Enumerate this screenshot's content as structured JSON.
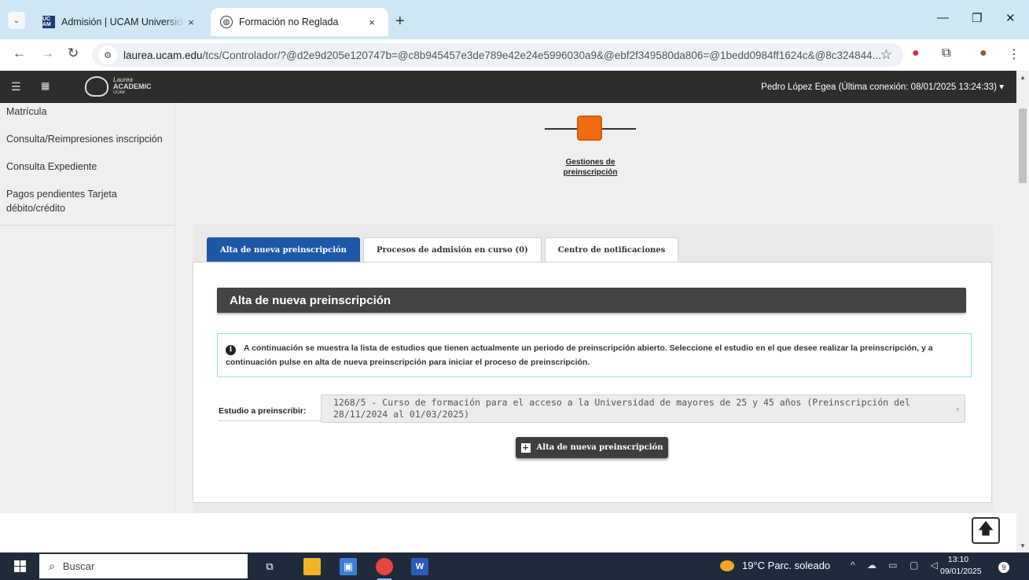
{
  "browser": {
    "tabs": [
      {
        "title": "Admisión | UCAM Universidad Católica de Murcia",
        "favicon": "UC AM",
        "active": false
      },
      {
        "title": "Formación no Reglada",
        "favicon": "globe-icon",
        "active": true
      }
    ],
    "new_tab": "+",
    "close": "×",
    "url_host": "laurea.ucam.edu",
    "url_path": "/tcs/Controlador/?@d2e9d205e120747b=@c8b945457e3de789e42e24e5996030a9&@ebf2f349580da806=@1bedd0984ff1624c&@8c324844..."
  },
  "app": {
    "logo_top": "Laurea",
    "logo_main": "ACADEMIC",
    "logo_sub": "UCAM",
    "user": "Pedro López Egea (Última conexión: 08/01/2025 13:24:33)"
  },
  "sidebar": {
    "items": [
      {
        "label": "Matrícula"
      },
      {
        "label": "Consulta/Reimpresiones inscripción"
      },
      {
        "label": "Consulta Expediente"
      },
      {
        "label": "Pagos pendientes Tarjeta débito/crédito"
      }
    ]
  },
  "stepper": {
    "label": "Gestiones de preinscripción"
  },
  "tabs": [
    {
      "label": "Alta de nueva preinscripción",
      "active": true
    },
    {
      "label": "Procesos de admisión en curso (0)",
      "active": false
    },
    {
      "label": "Centro de notificaciones",
      "active": false
    }
  ],
  "main": {
    "section_title": "Alta de nueva preinscripción",
    "info": "A continuación se muestra la lista de estudios que tienen actualmente un periodo de preinscripción abierto. Seleccione el estudio en el que desee realizar la preinscripción, y a continuación pulse en alta de nueva preinscripción para iniciar el proceso de preinscripción.",
    "field_label": "Estudio a preinscribir:",
    "selected_study": "1268/5 - Curso de formación para el acceso a la Universidad de mayores de 25 y 45 años (Preinscripción del 28/11/2024 al 01/03/2025)",
    "button_label": "Alta de nueva preinscripción"
  },
  "taskbar": {
    "search_placeholder": "Buscar",
    "weather": "19°C  Parc. soleado",
    "time": "13:10",
    "date": "09/01/2025",
    "notifications": "9"
  },
  "colors": {
    "accent_tab": "#1d57a8",
    "step": "#f26b11",
    "section_bar": "#444444",
    "info_border": "#8fe0e8"
  }
}
